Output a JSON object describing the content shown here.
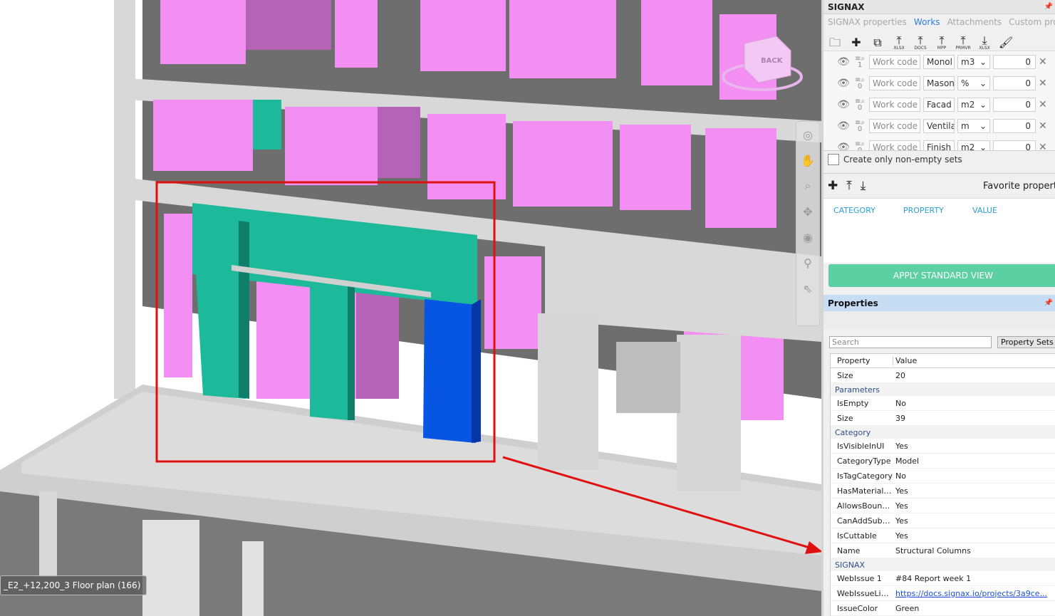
{
  "viewport": {
    "floor_label": "_E2_+12,200_3 Floor plan (166)",
    "viewcube_label": "BACK",
    "colors": {
      "pink": "#f38ef3",
      "pink_shade": "#b463b7",
      "teal": "#1cb99a",
      "blue": "#0755e3",
      "concrete": "#d8d8d8",
      "dark_gray": "#6b6b6b",
      "selection_red": "#e01010"
    },
    "nav_icons": [
      "steering-wheel-icon",
      "pan-icon",
      "zoom-icon",
      "orbit-icon",
      "look-icon",
      "walk-icon",
      "select-icon"
    ]
  },
  "panel": {
    "title": "SIGNAX",
    "tabs": [
      {
        "label": "SIGNAX properties",
        "active": false
      },
      {
        "label": "Works",
        "active": true
      },
      {
        "label": "Attachments",
        "active": false
      },
      {
        "label": "Custom properti",
        "active": false
      }
    ],
    "toolbar": [
      {
        "icon": "folder-add-icon",
        "caption": ""
      },
      {
        "icon": "plus-icon",
        "caption": ""
      },
      {
        "icon": "copy-icon",
        "caption": ""
      },
      {
        "icon": "upload-icon",
        "caption": "XLSX"
      },
      {
        "icon": "upload-icon",
        "caption": "DOCS"
      },
      {
        "icon": "upload-icon",
        "caption": "MPP"
      },
      {
        "icon": "upload-icon",
        "caption": "PRMVR"
      },
      {
        "icon": "download-icon",
        "caption": "XLSX"
      },
      {
        "icon": "brush-icon",
        "caption": ""
      }
    ],
    "works": [
      {
        "count": "1",
        "code_placeholder": "Work code",
        "name": "Monol",
        "unit": "m3",
        "qty": "0"
      },
      {
        "count": "0",
        "code_placeholder": "Work code",
        "name": "Mason",
        "unit": "%",
        "qty": "0"
      },
      {
        "count": "0",
        "code_placeholder": "Work code",
        "name": "Facad",
        "unit": "m2",
        "qty": "0"
      },
      {
        "count": "0",
        "code_placeholder": "Work code",
        "name": "Ventila",
        "unit": "m",
        "qty": "0"
      },
      {
        "count": "0",
        "code_placeholder": "Work code",
        "name": "Finish",
        "unit": "m2",
        "qty": "0"
      }
    ],
    "non_empty_label": "Create only non-empty sets",
    "favorite_label": "Favorite propert",
    "fav_columns": [
      "CATEGORY",
      "PROPERTY",
      "VALUE"
    ],
    "apply_button": "APPLY STANDARD VIEW"
  },
  "properties": {
    "title": "Properties",
    "search_placeholder": "Search",
    "property_sets_button": "Property Sets",
    "columns": [
      "Property",
      "Value"
    ],
    "rows": [
      {
        "type": "prop",
        "name": "Size",
        "value": "20"
      },
      {
        "type": "cat",
        "name": "Parameters"
      },
      {
        "type": "prop",
        "name": "IsEmpty",
        "value": "No"
      },
      {
        "type": "prop",
        "name": "Size",
        "value": "39"
      },
      {
        "type": "cat",
        "name": "Category"
      },
      {
        "type": "prop",
        "name": "IsVisibleInUI",
        "value": "Yes"
      },
      {
        "type": "prop",
        "name": "CategoryType",
        "value": "Model"
      },
      {
        "type": "prop",
        "name": "IsTagCategory",
        "value": "No"
      },
      {
        "type": "prop",
        "name": "HasMaterialQ...",
        "value": "Yes"
      },
      {
        "type": "prop",
        "name": "AllowsBound...",
        "value": "Yes"
      },
      {
        "type": "prop",
        "name": "CanAddSubc...",
        "value": "Yes"
      },
      {
        "type": "prop",
        "name": "IsCuttable",
        "value": "Yes"
      },
      {
        "type": "prop",
        "name": "Name",
        "value": "Structural Columns"
      },
      {
        "type": "cat",
        "name": "SIGNAX"
      },
      {
        "type": "prop",
        "name": "WebIssue 1",
        "value": "#84 Report week 1"
      },
      {
        "type": "link",
        "name": "WebIssueLin...",
        "value": "https://docs.signax.io/projects/3a9ce..."
      },
      {
        "type": "prop",
        "name": "IssueColor",
        "value": "Green"
      }
    ]
  }
}
